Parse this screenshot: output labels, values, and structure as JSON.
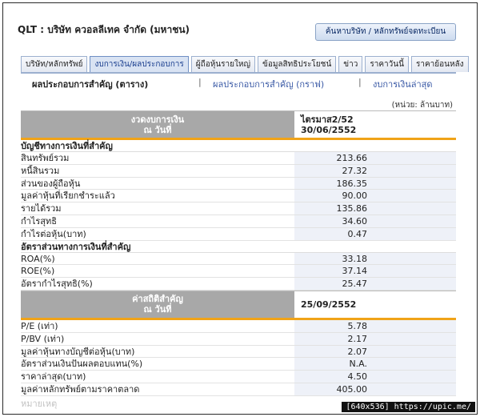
{
  "header": {
    "title": "QLT : บริษัท ควอลลีเทค จำกัด (มหาชน)",
    "search_button": "ค้นหาบริษัท / หลักทรัพย์จดทะเบียน"
  },
  "tabs": [
    {
      "label": "บริษัท/หลักทรัพย์"
    },
    {
      "label": "งบการเงิน/ผลประกอบการ",
      "active": true
    },
    {
      "label": "ผู้ถือหุ้นรายใหญ่"
    },
    {
      "label": "ข้อมูลสิทธิประโยชน์"
    },
    {
      "label": "ข่าว"
    },
    {
      "label": "ราคาวันนี้"
    },
    {
      "label": "ราคาย้อนหลัง"
    }
  ],
  "subnav": {
    "current": "ผลประกอบการสำคัญ (ตาราง)",
    "sep": "|",
    "graph_link": "ผลประกอบการสำคัญ (กราฟ)",
    "latest_link": "งบการเงินล่าสุด"
  },
  "unit": "(หน่วย: ล้านบาท)",
  "table1": {
    "head_label_1": "งวดงบการเงิน",
    "head_label_2": "ณ วันที่",
    "head_value_1": "ไตรมาส2/52",
    "head_value_2": "30/06/2552",
    "section_1": "บัญชีทางการเงินที่สำคัญ",
    "rows_1": [
      {
        "k": "สินทรัพย์รวม",
        "v": "213.66"
      },
      {
        "k": "หนี้สินรวม",
        "v": "27.32"
      },
      {
        "k": "ส่วนของผู้ถือหุ้น",
        "v": "186.35"
      },
      {
        "k": "มูลค่าหุ้นที่เรียกชำระแล้ว",
        "v": "90.00"
      },
      {
        "k": "รายได้รวม",
        "v": "135.86"
      },
      {
        "k": "กำไรสุทธิ",
        "v": "34.60"
      },
      {
        "k": "กำไรต่อหุ้น(บาท)",
        "v": "0.47"
      }
    ],
    "section_2": "อัตราส่วนทางการเงินที่สำคัญ",
    "rows_2": [
      {
        "k": "ROA(%)",
        "v": "33.18"
      },
      {
        "k": "ROE(%)",
        "v": "37.14"
      },
      {
        "k": "อัตรากำไรสุทธิ(%)",
        "v": "25.47"
      }
    ]
  },
  "table2": {
    "head_label_1": "ค่าสถิติสำคัญ",
    "head_label_2": "ณ วันที่",
    "head_value": "25/09/2552",
    "rows": [
      {
        "k": "P/E (เท่า)",
        "v": "5.78"
      },
      {
        "k": "P/BV (เท่า)",
        "v": "2.17"
      },
      {
        "k": "มูลค่าหุ้นทางบัญชีต่อหุ้น(บาท)",
        "v": "2.07"
      },
      {
        "k": "อัตราส่วนเงินปันผลตอบแทน(%)",
        "v": "N.A."
      },
      {
        "k": "ราคาล่าสุด(บาท)",
        "v": "4.50"
      },
      {
        "k": "มูลค่าหลักทรัพย์ตามราคาตลาด",
        "v": "405.00"
      }
    ],
    "footer_fade": "หมายเหตุ"
  },
  "watermark": "[640x536] https://upic.me/"
}
